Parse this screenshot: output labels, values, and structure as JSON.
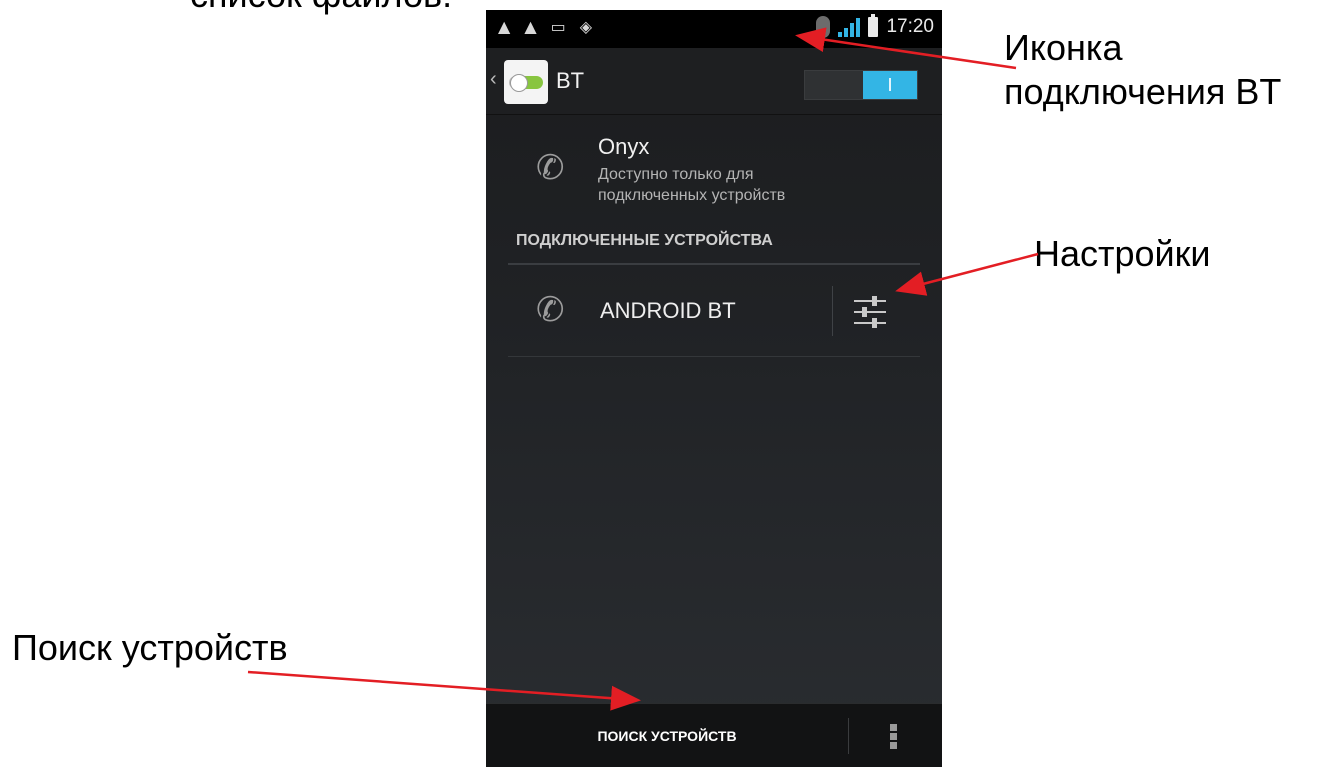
{
  "top_caption": "список файлов.",
  "status_bar": {
    "time": "17:20",
    "left_icons": [
      "warning-icon",
      "warning-icon",
      "image-icon",
      "wifi-icon"
    ],
    "accent_color": "#33b5e5"
  },
  "action_bar": {
    "up_glyph": "‹",
    "title": "BT",
    "toggle_label": "I",
    "toggle_state": "on"
  },
  "this_device": {
    "name": "Onyx",
    "visibility": "Доступно только для подключенных устройств"
  },
  "paired_section": {
    "header": "ПОДКЛЮЧЕННЫЕ УСТРОЙСТВА",
    "devices": [
      {
        "name": "ANDROID BT"
      }
    ]
  },
  "bottom_bar": {
    "scan_label": "ПОИСК УСТРОЙСТВ"
  },
  "annotations": {
    "bt_icon": "Иконка\nподключения BT",
    "settings": "Настройки",
    "scan": "Поиск устройств",
    "arrow_color": "#e31e24"
  }
}
